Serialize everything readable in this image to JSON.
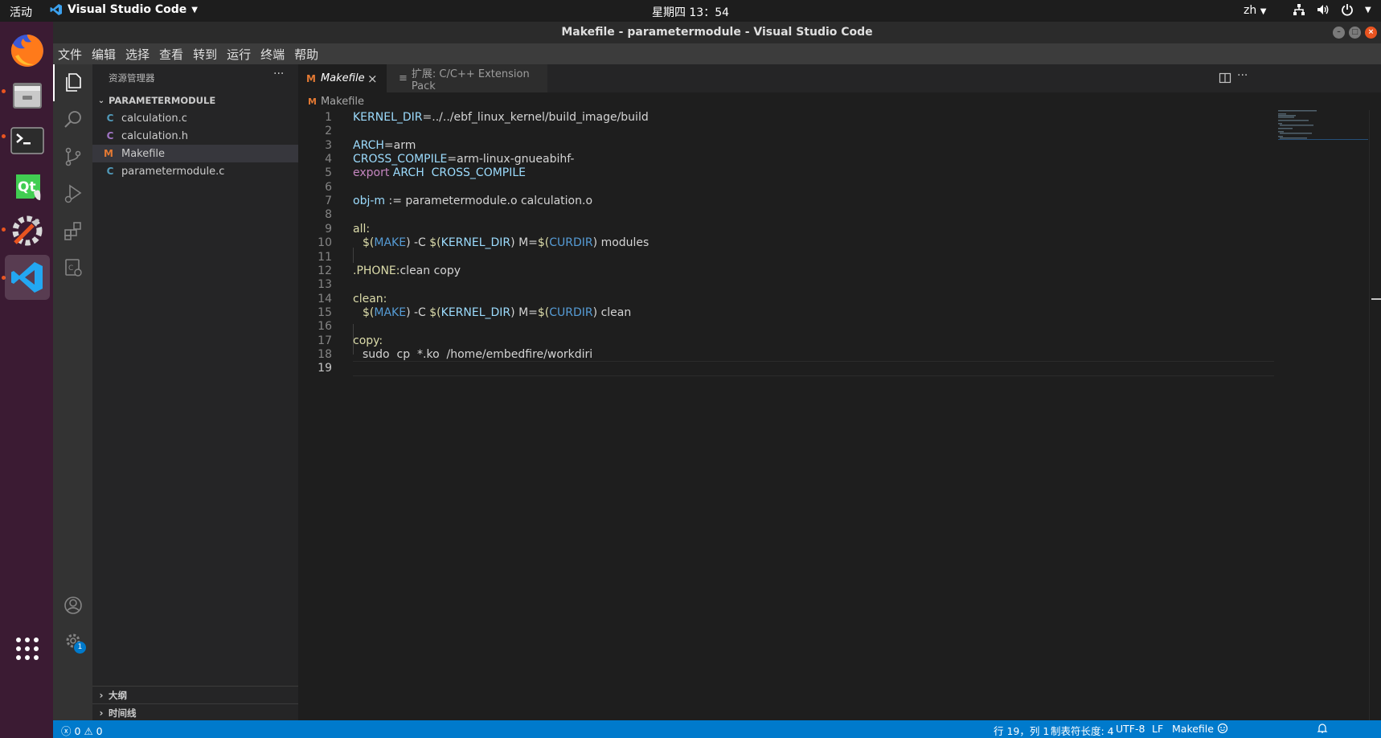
{
  "topbar": {
    "activities": "活动",
    "app_name": "Visual Studio Code",
    "clock": "星期四 13：54",
    "lang": "zh"
  },
  "window": {
    "title": "Makefile - parametermodule - Visual Studio Code"
  },
  "menu": [
    "文件",
    "编辑",
    "选择",
    "查看",
    "转到",
    "运行",
    "终端",
    "帮助"
  ],
  "dock": {
    "apps": [
      "firefox-icon",
      "files-icon",
      "terminal-icon",
      "qt-creator-icon",
      "settings-tool-icon",
      "vscode-icon"
    ],
    "show_apps": "apps-grid-icon"
  },
  "activitybar": {
    "settings_badge": "1"
  },
  "sidebar": {
    "title": "资源管理器",
    "more": "···",
    "folder": "PARAMETERMODULE",
    "files": [
      {
        "icon": "C",
        "name": "calculation.c",
        "color": "#519aba"
      },
      {
        "icon": "C",
        "name": "calculation.h",
        "color": "#a074c4"
      },
      {
        "icon": "M",
        "name": "Makefile",
        "color": "#e37933"
      },
      {
        "icon": "C",
        "name": "parametermodule.c",
        "color": "#519aba"
      }
    ],
    "outline": "大纲",
    "timeline": "时间线"
  },
  "tabs": [
    {
      "icon": "M",
      "label": "Makefile",
      "close": "×"
    },
    {
      "icon": "≡",
      "label": "扩展: C/C++ Extension Pack"
    }
  ],
  "breadcrumb": {
    "icon": "M",
    "file": "Makefile"
  },
  "code_lines": [
    "1",
    "2",
    "3",
    "4",
    "5",
    "6",
    "7",
    "8",
    "9",
    "10",
    "11",
    "12",
    "13",
    "14",
    "15",
    "16",
    "17",
    "18",
    "19"
  ],
  "code": {
    "l1_var": "KERNEL_DIR",
    "l1_rest": "=../../ebf_linux_kernel/build_image/build",
    "l3_var": "ARCH",
    "l3_rest": "=arm",
    "l4_var": "CROSS_COMPILE",
    "l4_rest": "=arm-linux-gnueabihf-",
    "l5_kw": "export",
    "l5_rest": " ARCH  CROSS_COMPILE",
    "l7_var": "obj-m",
    "l7_rest": " := parametermodule.o calculation.o",
    "l9_target": "all:",
    "l10_a": "$(",
    "l10_b": "MAKE",
    "l10_c": ") -C ",
    "l10_d": "$(",
    "l10_e": "KERNEL_DIR",
    "l10_f": ") M=",
    "l10_g": "$(",
    "l10_h": "CURDIR",
    "l10_i": ") modules",
    "l12_target": ".PHONE:",
    "l12_rest": "clean copy",
    "l14_target": "clean:",
    "l15_i": ") clean",
    "l17_target": "copy:",
    "l18_rest": "sudo  cp  *.ko  /home/embedfire/workdiri"
  },
  "statusbar": {
    "errors": "0",
    "warnings": "0",
    "position": "行 19，列 1",
    "tabsize": "制表符长度: 4",
    "encoding": "UTF-8",
    "eol": "LF",
    "language": "Makefile"
  },
  "colors": {
    "accent": "#007acc",
    "dock_bg": "#3b1b33",
    "ubuntu_orange": "#e95420"
  }
}
